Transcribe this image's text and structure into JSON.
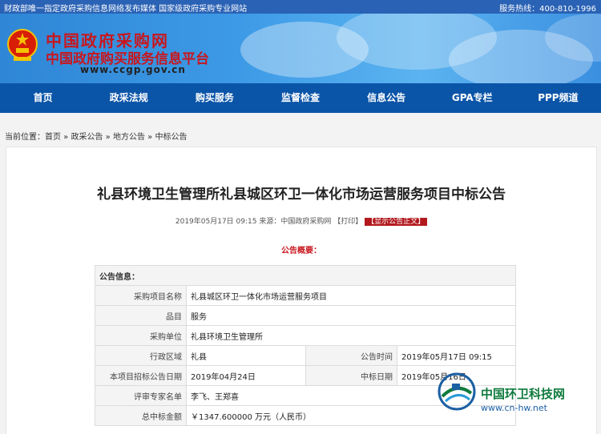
{
  "topbar": {
    "left_text": "财政部唯一指定政府采购信息网络发布媒体 国家级政府采购专业网站",
    "hotline": "服务热线：400-810-1996"
  },
  "header": {
    "site_name": "中国政府采购网",
    "site_subtitle": "中国政府购买服务信息平台",
    "site_url": "www.ccgp.gov.cn"
  },
  "nav": {
    "items": [
      "首页",
      "政采法规",
      "购买服务",
      "监督检查",
      "信息公告",
      "GPA专栏",
      "PPP频道"
    ]
  },
  "breadcrumb": {
    "label": "当前位置：",
    "items": [
      "首页",
      "政采公告",
      "地方公告",
      "中标公告"
    ],
    "separator": " » "
  },
  "article": {
    "title": "礼县环境卫生管理所礼县城区环卫一体化市场运营服务项目中标公告",
    "meta_prefix": "2019年05月17日 09:15 来源：中国政府采购网 【打印】",
    "show_body_button": "【显示公告正文】",
    "summary_heading": "公告概要："
  },
  "info_table": {
    "section_header": "公告信息：",
    "project_name_label": "采购项目名称",
    "project_name": "礼县城区环卫一体化市场运营服务项目",
    "category_label": "品目",
    "category": "服务",
    "buyer_label": "采购单位",
    "buyer": "礼县环境卫生管理所",
    "region_label": "行政区域",
    "region": "礼县",
    "announce_time_label": "公告时间",
    "announce_time": "2019年05月17日 09:15",
    "tender_date_label": "本项目招标公告日期",
    "tender_date": "2019年04月24日",
    "award_date_label": "中标日期",
    "award_date": "2019年05月16日",
    "experts_label": "评审专家名单",
    "experts": "李飞、王郑喜",
    "amount_label": "总中标金额",
    "amount": "￥1347.600000 万元（人民币）"
  },
  "watermark": {
    "title": "中国环卫科技网",
    "url": "www.cn-hw.net"
  },
  "colors": {
    "topbar": "#2a62b5",
    "nav": "#0b55a8",
    "brand_red": "#c8171e",
    "watermark_green": "#0f7a3d"
  }
}
